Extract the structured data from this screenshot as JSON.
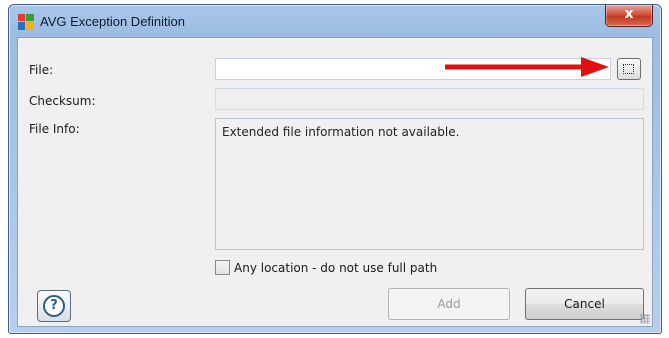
{
  "window": {
    "title": "AVG Exception Definition",
    "close_glyph": "x"
  },
  "form": {
    "file_label": "File:",
    "file_value": "",
    "checksum_label": "Checksum:",
    "checksum_value": "",
    "fileinfo_label": "File Info:",
    "fileinfo_text": "Extended file information not available.",
    "any_location_label": "Any location - do not use full path",
    "any_location_checked": false
  },
  "buttons": {
    "add": "Add",
    "cancel": "Cancel",
    "help_glyph": "?"
  },
  "icons": {
    "app": "avg-logo-icon",
    "browse": "browse-icon",
    "help": "help-icon",
    "arrow": "red-arrow-annotation"
  },
  "colors": {
    "arrow": "#e01010",
    "close": "#c0391f",
    "titlebar": "#aac7ea"
  }
}
